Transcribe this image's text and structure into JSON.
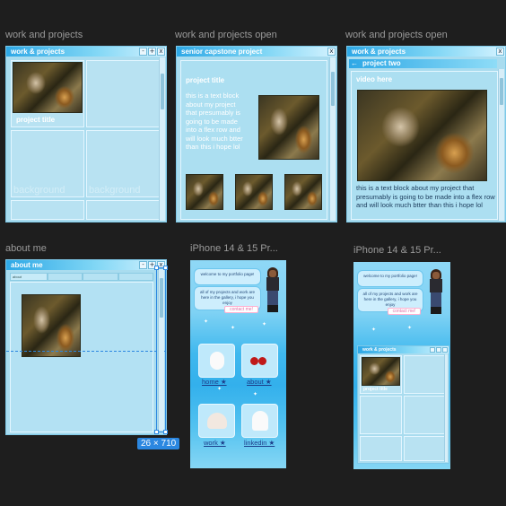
{
  "frames": {
    "f1": {
      "label": "work and projects"
    },
    "f2": {
      "label": "work and projects open"
    },
    "f3": {
      "label": "work and projects open"
    },
    "f4": {
      "label": "about me"
    },
    "f5": {
      "label": "iPhone 14 & 15 Pr..."
    },
    "f6": {
      "label": "iPhone 14 & 15 Pr..."
    }
  },
  "win1": {
    "title": "work & projects",
    "card_label": "project title",
    "bg_word": "background"
  },
  "win2": {
    "title": "senior capstone project",
    "project_title": "project title",
    "body": "this is a text block about my project that presumably is going to be made into a flex row and will look much btter than this i hope lol"
  },
  "win3": {
    "title": "work & projects",
    "subtitle": "project two",
    "video_label": "video here",
    "body": "this is a text block about my project that presumably is going to be made into a flex row and will look much btter than this i hope lol"
  },
  "win4": {
    "title": "about me",
    "tab1": "about"
  },
  "titlebar_buttons": {
    "min": "-",
    "max": "+",
    "close": "x"
  },
  "selection": {
    "dimensions": "26 × 710"
  },
  "phone1": {
    "bubble1": "welcome to my portfolio page!",
    "bubble2": "all of my projects and work are here in the gallery, i hope you enjoy",
    "contact_button": "contact me!",
    "nav": {
      "home": "home ★",
      "about": "about ★",
      "work": "work ★",
      "linkedin": "linkedin ★"
    }
  },
  "phone2": {
    "bubble1": "welcome to my portfolio page!",
    "bubble2": "all of my projects and work are here in the gallery, i hope you enjoy",
    "contact_button": "contact me!",
    "mini_window_title": "work & projects",
    "mini_card_label": "project title"
  },
  "colors": {
    "canvas": "#1e1e1e",
    "window": "#a9dcef",
    "titlebar_start": "#2ea8e6",
    "selection": "#2b87e0"
  }
}
